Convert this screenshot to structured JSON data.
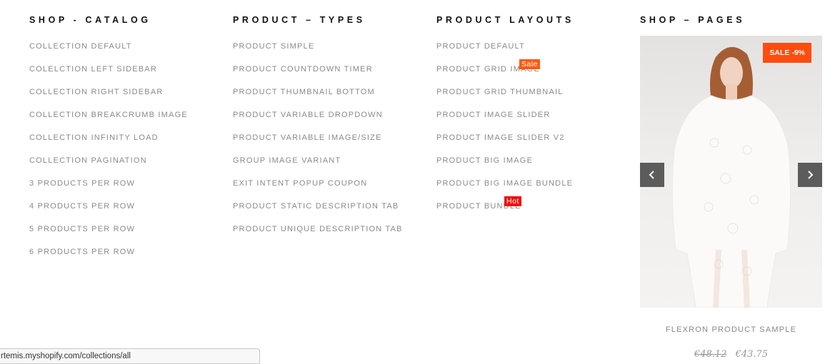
{
  "columns": [
    {
      "title": "SHOP - CATALOG",
      "items": [
        {
          "label": "COLLECTION DEFAULT"
        },
        {
          "label": "COLELCTION LEFT SIDEBAR"
        },
        {
          "label": "COLLECTION RIGHT SIDEBAR"
        },
        {
          "label": "COLLECTION BREAKCRUMB IMAGE"
        },
        {
          "label": "COLLECTION INFINITY LOAD"
        },
        {
          "label": "COLLECTION PAGINATION"
        },
        {
          "label": "3 PRODUCTS PER ROW"
        },
        {
          "label": "4 PRODUCTS PER ROW"
        },
        {
          "label": "5 PRODUCTS PER ROW"
        },
        {
          "label": "6 PRODUCTS PER ROW"
        }
      ]
    },
    {
      "title": "PRODUCT – TYPES",
      "items": [
        {
          "label": "PRODUCT SIMPLE"
        },
        {
          "label": "PRODUCT COUNTDOWN TIMER"
        },
        {
          "label": "PRODUCT THUMBNAIL BOTTOM"
        },
        {
          "label": "PRODUCT VARIABLE DROPDOWN"
        },
        {
          "label": "PRODUCT VARIABLE IMAGE/SIZE"
        },
        {
          "label": "GROUP IMAGE VARIANT"
        },
        {
          "label": "EXIT INTENT POPUP COUPON"
        },
        {
          "label": "PRODUCT STATIC DESCRIPTION TAB"
        },
        {
          "label": "PRODUCT UNIQUE DESCRIPTION TAB"
        }
      ]
    },
    {
      "title": "PRODUCT LAYOUTS",
      "items": [
        {
          "label": "PRODUCT DEFAULT"
        },
        {
          "label": "PRODUCT GRID IMAGE",
          "badge": "Sale"
        },
        {
          "label": "PRODUCT GRID THUMBNAIL"
        },
        {
          "label": "PRODUCT IMAGE SLIDER"
        },
        {
          "label": "PRODUCT IMAGE SLIDER V2"
        },
        {
          "label": "PRODUCT BIG IMAGE"
        },
        {
          "label": "PRODUCT BIG IMAGE BUNDLE"
        },
        {
          "label": "PRODUCT BUNDLE",
          "badge": "Hot"
        }
      ]
    },
    {
      "title": "SHOP – PAGES"
    }
  ],
  "product": {
    "sale_tag": "SALE -9%",
    "name": "FLEXRON PRODUCT SAMPLE",
    "old_price": "€48.12",
    "price": "€43.75",
    "image_icon": "dress-product-image",
    "prev_icon": "chevron-left-icon",
    "next_icon": "chevron-right-icon"
  },
  "status_bar": {
    "url": "rtemis.myshopify.com/collections/all"
  },
  "colors": {
    "sale_badge": "#ff5b0f",
    "hot_badge": "#f01010",
    "sale_tag": "#ff4c0f",
    "slider_button": "#5c5c5c",
    "menu_text": "#8a8a8a",
    "heading_text": "#111111"
  }
}
